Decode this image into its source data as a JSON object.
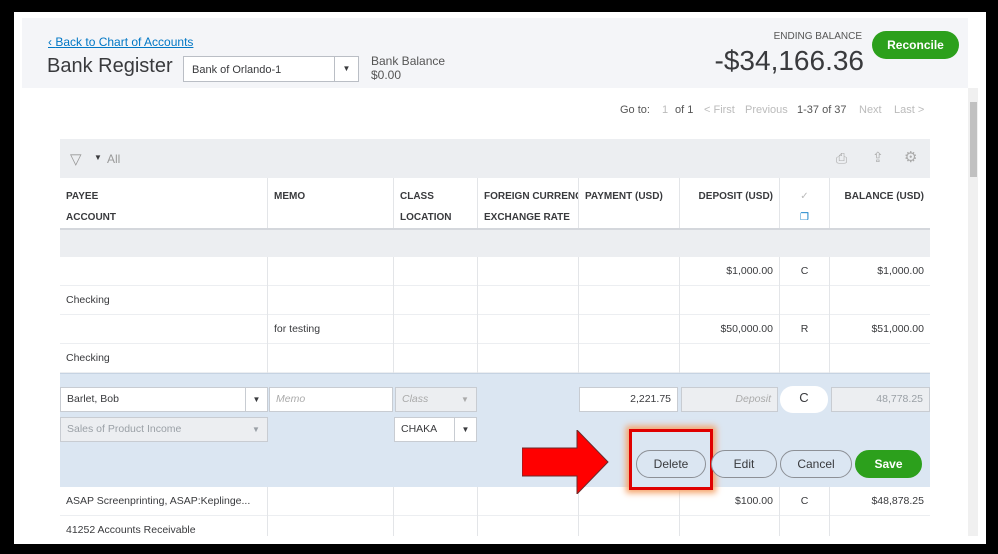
{
  "header": {
    "back_link": "Back to Chart of Accounts",
    "title": "Bank Register",
    "account": "Bank of Orlando-1",
    "bank_balance_label": "Bank Balance",
    "bank_balance": "$0.00",
    "ending_balance_label": "ENDING BALANCE",
    "ending_balance": "-$34,166.36",
    "reconcile": "Reconcile"
  },
  "pager": {
    "goto": "Go to:",
    "page": "1",
    "of": "of 1",
    "first": "< First",
    "previous": "Previous",
    "range": "1-37 of 37",
    "next": "Next",
    "last": "Last >"
  },
  "toolbar": {
    "filter": "All",
    "icons": [
      "filter-icon",
      "print-icon",
      "export-icon",
      "gear-icon"
    ]
  },
  "columns": {
    "payee": "PAYEE",
    "account": "ACCOUNT",
    "memo": "MEMO",
    "class": "CLASS",
    "location": "LOCATION",
    "foreign": "FOREIGN CURRENCY",
    "exchange": "EXCHANGE RATE",
    "payment": "PAYMENT (USD)",
    "deposit": "DEPOSIT (USD)",
    "check": "✓",
    "balance": "BALANCE (USD)"
  },
  "rows": [
    {
      "payee": "",
      "account": "Checking",
      "memo": "",
      "deposit": "$1,000.00",
      "status": "C",
      "balance": "$1,000.00"
    },
    {
      "payee": "",
      "account": "Checking",
      "memo": "for testing",
      "deposit": "$50,000.00",
      "status": "R",
      "balance": "$51,000.00"
    },
    {
      "payee": "ASAP Screenprinting, ASAP:Keplinge...",
      "account": "41252 Accounts Receivable",
      "memo": "",
      "deposit": "$100.00",
      "status": "C",
      "balance": "$48,878.25"
    }
  ],
  "edit_row": {
    "payee": "Barlet, Bob",
    "memo_placeholder": "Memo",
    "class_placeholder": "Class",
    "account": "Sales of Product Income",
    "location": "CHAKA",
    "payment": "2,221.75",
    "deposit_placeholder": "Deposit",
    "status": "C",
    "balance": "48,778.25"
  },
  "actions": {
    "delete": "Delete",
    "edit": "Edit",
    "cancel": "Cancel",
    "save": "Save"
  },
  "colors": {
    "accent": "#2ca01c",
    "link": "#0077c5",
    "highlight": "#ff0000"
  }
}
